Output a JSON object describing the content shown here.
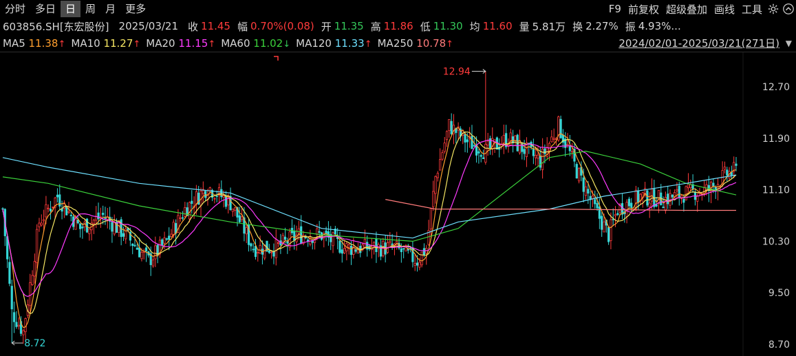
{
  "toolbar": {
    "tabs": [
      {
        "label": "分时",
        "active": false
      },
      {
        "label": "多日",
        "active": false
      },
      {
        "label": "日",
        "active": true
      },
      {
        "label": "周",
        "active": false
      },
      {
        "label": "月",
        "active": false
      },
      {
        "label": "更多",
        "active": false
      }
    ],
    "tools": [
      "F9",
      "前复权",
      "超级叠加",
      "画线",
      "工具"
    ],
    "icons": [
      "gear-icon",
      "chevron-up-icon"
    ]
  },
  "quote": {
    "code": "603856.SH[东宏股份]",
    "date": "2025/03/21",
    "close_label": "收",
    "close": "11.45",
    "change_label": "幅",
    "change": "0.70%(0.08)",
    "open_label": "开",
    "open": "11.35",
    "high_label": "高",
    "high": "11.86",
    "low_label": "低",
    "low": "11.30",
    "avg_label": "均",
    "avg": "11.60",
    "volume_label": "量",
    "volume": "5.81万",
    "turnover_label": "换",
    "turnover": "2.27%",
    "amplitude_label": "振",
    "amplitude": "4.93%...",
    "colors": {
      "up": "#ff3b3b",
      "down": "#34c759",
      "neutral": "#d6d6d6"
    }
  },
  "ma_legend": {
    "items": [
      {
        "label": "MA5",
        "value": "11.38",
        "arrow": "↑",
        "color": "#ff9f2e"
      },
      {
        "label": "MA10",
        "value": "11.27",
        "arrow": "↑",
        "color": "#f5e663"
      },
      {
        "label": "MA20",
        "value": "11.15",
        "arrow": "↑",
        "color": "#ff3bff"
      },
      {
        "label": "MA60",
        "value": "11.02",
        "arrow": "↓",
        "color": "#3bd13b"
      },
      {
        "label": "MA120",
        "value": "11.33",
        "arrow": "↑",
        "color": "#6ee0ff"
      },
      {
        "label": "MA250",
        "value": "10.78",
        "arrow": "↑",
        "color": "#ff7b7b"
      }
    ],
    "range": "2024/02/01-2025/03/21(271日)"
  },
  "chart_data": {
    "type": "candlestick",
    "y_ticks": [
      "12.70",
      "11.90",
      "11.10",
      "10.30",
      "9.50",
      "8.70"
    ],
    "ylim": [
      8.7,
      12.94
    ],
    "annotations": {
      "max": "12.94",
      "min": "8.72"
    },
    "grid": false,
    "colors": {
      "up": "#ff3b3b",
      "down": "#35d6d6",
      "bg": "#000000"
    },
    "price_path": [
      [
        0,
        10.8
      ],
      [
        4,
        9.2
      ],
      [
        9,
        8.9
      ],
      [
        16,
        10.6
      ],
      [
        24,
        11.0
      ],
      [
        34,
        10.5
      ],
      [
        44,
        10.7
      ],
      [
        54,
        10.4
      ],
      [
        64,
        10.0
      ],
      [
        72,
        10.3
      ],
      [
        80,
        10.8
      ],
      [
        90,
        11.15
      ],
      [
        100,
        10.9
      ],
      [
        110,
        10.2
      ],
      [
        120,
        10.2
      ],
      [
        130,
        10.4
      ],
      [
        140,
        10.4
      ],
      [
        150,
        10.2
      ],
      [
        160,
        10.2
      ],
      [
        172,
        10.2
      ],
      [
        182,
        10.0
      ],
      [
        186,
        10.2
      ],
      [
        190,
        11.3
      ],
      [
        196,
        12.1
      ],
      [
        204,
        11.85
      ],
      [
        212,
        11.7
      ],
      [
        222,
        11.9
      ],
      [
        228,
        11.75
      ],
      [
        236,
        11.55
      ],
      [
        244,
        12.1
      ],
      [
        252,
        11.4
      ],
      [
        260,
        10.8
      ],
      [
        266,
        10.4
      ],
      [
        270,
        10.8
      ],
      [
        280,
        11.0
      ],
      [
        290,
        10.95
      ],
      [
        300,
        11.05
      ],
      [
        310,
        11.1
      ],
      [
        318,
        11.35
      ],
      [
        322,
        11.4
      ]
    ],
    "ma_paths": {
      "MA120": [
        [
          0,
          11.6
        ],
        [
          20,
          11.45
        ],
        [
          60,
          11.2
        ],
        [
          100,
          11.05
        ],
        [
          140,
          10.5
        ],
        [
          180,
          10.35
        ],
        [
          200,
          10.6
        ],
        [
          240,
          10.8
        ],
        [
          264,
          11.0
        ],
        [
          300,
          11.2
        ],
        [
          322,
          11.33
        ]
      ],
      "MA60": [
        [
          0,
          11.3
        ],
        [
          20,
          11.2
        ],
        [
          60,
          10.85
        ],
        [
          100,
          10.6
        ],
        [
          140,
          10.4
        ],
        [
          180,
          10.3
        ],
        [
          200,
          10.5
        ],
        [
          240,
          11.6
        ],
        [
          256,
          11.7
        ],
        [
          280,
          11.5
        ],
        [
          300,
          11.2
        ],
        [
          322,
          11.02
        ]
      ],
      "MA250": [
        [
          168,
          10.95
        ],
        [
          190,
          10.8
        ],
        [
          240,
          10.8
        ],
        [
          300,
          10.78
        ],
        [
          322,
          10.78
        ]
      ]
    }
  }
}
